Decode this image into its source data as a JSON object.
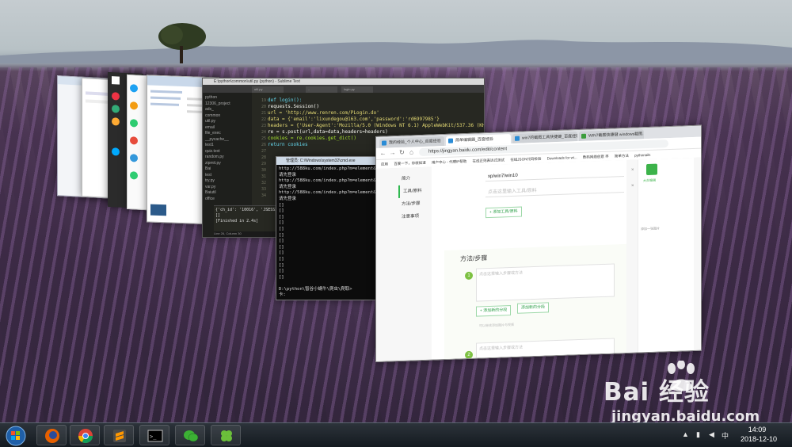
{
  "sublime": {
    "title": "E:\\python\\common\\util.py (python) - Sublime Text",
    "tabs": [
      "util.py",
      "..",
      "login.py"
    ],
    "sidebar": [
      "python",
      "12306_project",
      "ads_",
      "common",
      "util.py",
      "email",
      "file_exec",
      "__pycache__",
      "test1",
      "quiz.text",
      "random.py",
      "zipmit.py",
      "Bai",
      "test",
      "try.py",
      "var.py",
      "Baiutil",
      "office"
    ],
    "gutter": [
      "19",
      "20",
      "21",
      "22",
      "23",
      "24",
      "25",
      "26",
      "27",
      "28",
      "29",
      "30",
      "31",
      "32",
      "33",
      "34"
    ],
    "code": [
      "def login():",
      "    requests.Session()",
      "    url = 'http://www.renren.com/PLogin.do'",
      "    data = {'email':'lixundegou@163.com','password':'rd6997985'}",
      "    headers = {'User-Agent':'Mozilla/5.0 (Windows NT 6.1) AppleWebKit/537.36 (KHTML, like",
      "    re = s.post(url,data=data,headers=headers)",
      "    cookies = re.cookies.get_dict()",
      "    return cookies"
    ],
    "console": [
      "{'ch_id': '10016', 'JSESSI",
      "[]",
      "[Finished in 2.4s]"
    ],
    "status": "Line 26, Column 30"
  },
  "cmd": {
    "title": "管理员: C:\\Windows\\system32\\cmd.exe",
    "lines": [
      "http://588ku.com/index.php?m=element&a=de",
      "请先登录",
      "http://588ku.com/index.php?m=element&a=de",
      "请先登录",
      "http://588ku.com/index.php?m=element&a=de",
      "请先登录",
      "[]",
      "[]",
      "[]",
      "[]",
      "[]",
      "[]",
      "[]",
      "[]",
      "[]",
      "[]",
      "[]",
      "[]",
      "[]",
      "",
      "D:\\python\\智谷小蜗牛\\爬虫\\爬取>",
      "卡:"
    ]
  },
  "chrome": {
    "tabs": [
      "我的经验_个人中心_百度经验",
      "简单编辑器_百度经验",
      "win7的截图工具快捷键_百度经验",
      "WIN7截图快捷键 windows截图..."
    ],
    "url": "https://jingyan.baidu.com/edit/content",
    "bookmarks": [
      "应用",
      "百度一下，你就知道",
      "用户中心 - 代理IP帮助",
      "在线正则表达式测试",
      "在线JSON代码检验",
      "Downloads for wi...",
      "数码网络创意 丰",
      "简单方法",
      "pythonails"
    ],
    "leftnav": [
      "简介",
      "工具/原料",
      "方法/步骤",
      "注意事项"
    ],
    "tool_value": "xp/win7/win10",
    "tool_placeholder": "点击这里输入工具/原料",
    "add_tool": "+ 添加工具/原料",
    "steps_title": "方法/步骤",
    "step_placeholder": "点击这里输入步骤或方法",
    "add_step": "+ 添加新的分段",
    "add_img": "添加新的分段",
    "step_hint": "可以继续添加图片与视频",
    "step2_placeholder": "点击这里输入步骤或方法",
    "right_logo_text": "大众编辑",
    "right_side_text": "添加一张图片"
  },
  "taskbar": {
    "apps": [
      "firefox-icon",
      "chrome-icon",
      "sublime-icon",
      "cmd-icon",
      "wechat-icon",
      "clover-icon"
    ],
    "time": "14:09",
    "date": "2018-12-10",
    "tray_text": "中"
  },
  "watermark": {
    "brand": "Bai  经验",
    "url": "jingyan.baidu.com"
  },
  "colors": {
    "accent_green": "#30b84f",
    "taskbar": "#1b2229"
  }
}
